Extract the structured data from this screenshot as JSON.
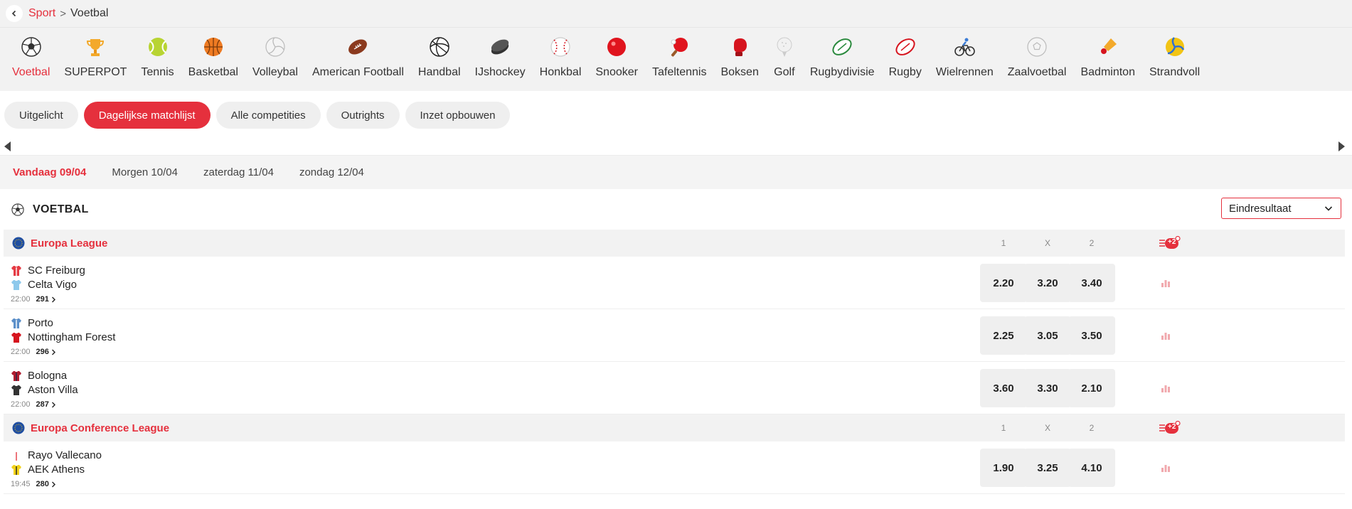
{
  "breadcrumb": {
    "back": "‹",
    "parent": "Sport",
    "separator": ">",
    "current": "Voetbal"
  },
  "sports": [
    {
      "label": "Voetbal",
      "icon": "soccer-ball-icon",
      "active": true
    },
    {
      "label": "SUPERPOT",
      "icon": "trophy-icon"
    },
    {
      "label": "Tennis",
      "icon": "tennis-ball-icon"
    },
    {
      "label": "Basketbal",
      "icon": "basketball-icon"
    },
    {
      "label": "Volleybal",
      "icon": "volleyball-icon"
    },
    {
      "label": "American Football",
      "icon": "american-football-icon"
    },
    {
      "label": "Handbal",
      "icon": "handball-icon"
    },
    {
      "label": "IJshockey",
      "icon": "hockey-puck-icon"
    },
    {
      "label": "Honkbal",
      "icon": "baseball-icon"
    },
    {
      "label": "Snooker",
      "icon": "snooker-ball-icon"
    },
    {
      "label": "Tafeltennis",
      "icon": "table-tennis-icon"
    },
    {
      "label": "Boksen",
      "icon": "boxing-glove-icon"
    },
    {
      "label": "Golf",
      "icon": "golf-ball-icon"
    },
    {
      "label": "Rugbydivisie",
      "icon": "rugby-ball-icon"
    },
    {
      "label": "Rugby",
      "icon": "rugby-ball-icon"
    },
    {
      "label": "Wielrennen",
      "icon": "cyclist-icon"
    },
    {
      "label": "Zaalvoetbal",
      "icon": "futsal-ball-icon"
    },
    {
      "label": "Badminton",
      "icon": "shuttlecock-icon"
    },
    {
      "label": "Strandvoll",
      "icon": "beach-volleyball-icon"
    }
  ],
  "tabs": [
    {
      "label": "Uitgelicht"
    },
    {
      "label": "Dagelijkse matchlijst",
      "active": true
    },
    {
      "label": "Alle competities"
    },
    {
      "label": "Outrights"
    },
    {
      "label": "Inzet opbouwen"
    }
  ],
  "days": [
    {
      "label": "Vandaag 09/04",
      "active": true
    },
    {
      "label": "Morgen 10/04"
    },
    {
      "label": "zaterdag 11/04"
    },
    {
      "label": "zondag 12/04"
    }
  ],
  "section": {
    "title": "VOETBAL",
    "market": "Eindresultaat"
  },
  "leagues": [
    {
      "name": "Europa League",
      "more_badge": "+2",
      "cols": [
        "1",
        "X",
        "2"
      ],
      "matches": [
        {
          "home": "SC Freiburg",
          "away": "Celta Vigo",
          "time": "22:00",
          "markets": "291",
          "odds": [
            "2.20",
            "3.20",
            "3.40"
          ],
          "home_colors": [
            "#e53a43",
            "#ffffff"
          ],
          "away_colors": [
            "#8ec9ec",
            "#8ec9ec"
          ]
        },
        {
          "home": "Porto",
          "away": "Nottingham Forest",
          "time": "22:00",
          "markets": "296",
          "odds": [
            "2.25",
            "3.05",
            "3.50"
          ],
          "home_colors": [
            "#5b8fc9",
            "#ffffff"
          ],
          "away_colors": [
            "#d6141e",
            "#d6141e"
          ]
        },
        {
          "home": "Bologna",
          "away": "Aston Villa",
          "time": "22:00",
          "markets": "287",
          "odds": [
            "3.60",
            "3.30",
            "2.10"
          ],
          "home_colors": [
            "#b01c2e",
            "#1c2a4a"
          ],
          "away_colors": [
            "#333333",
            "#333333"
          ]
        }
      ]
    },
    {
      "name": "Europa Conference League",
      "more_badge": "+2",
      "cols": [
        "1",
        "X",
        "2"
      ],
      "matches": [
        {
          "home": "Rayo Vallecano",
          "away": "AEK Athens",
          "time": "19:45",
          "markets": "280",
          "odds": [
            "1.90",
            "3.25",
            "4.10"
          ],
          "home_colors": [
            "#ffffff",
            "#e53a43"
          ],
          "away_colors": [
            "#f2d21a",
            "#222222"
          ]
        }
      ]
    }
  ]
}
